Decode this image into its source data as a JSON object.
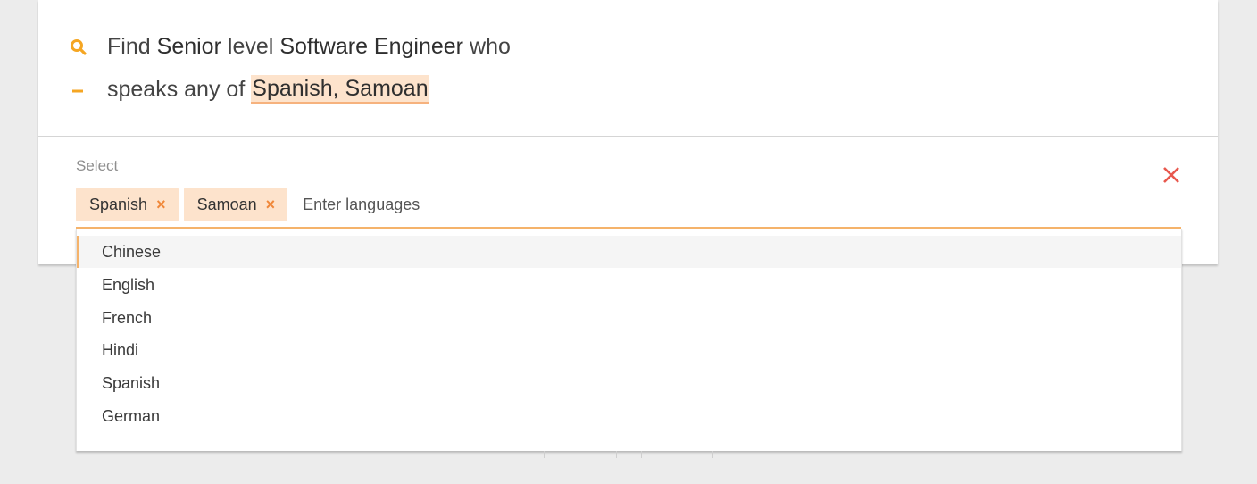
{
  "query": {
    "line1": {
      "find": "Find",
      "level_value": "Senior",
      "level_word": "level",
      "role_value": "Software Engineer",
      "who": "who"
    },
    "line2": {
      "prefix": "speaks any of",
      "languages_value": "Spanish, Samoan"
    }
  },
  "select": {
    "label": "Select",
    "tags": [
      {
        "label": "Spanish",
        "remove": "×"
      },
      {
        "label": "Samoan",
        "remove": "×"
      }
    ],
    "input_placeholder": "Enter languages"
  },
  "dropdown": {
    "options": [
      "Chinese",
      "English",
      "French",
      "Hindi",
      "Spanish",
      "German"
    ],
    "active_option": "Chinese"
  },
  "colors": {
    "accent": "#f5b36b",
    "tag_bg": "#fde3cc",
    "close": "#e8574d",
    "search_icon": "#f5a623"
  },
  "icons": {
    "query_icon": "search-icon",
    "sub_icon": "dash-icon",
    "close_icon": "close-icon",
    "tag_remove_icon": "remove-tag-icon"
  }
}
